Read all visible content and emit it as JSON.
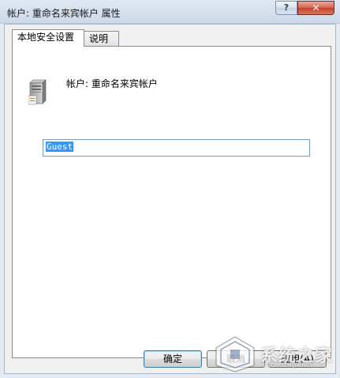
{
  "window": {
    "title": "帐户: 重命名来宾帐户 属性",
    "help_label": "?",
    "close_label": "✕"
  },
  "tabs": [
    {
      "label": "本地安全设置",
      "active": true
    },
    {
      "label": "说明",
      "active": false
    }
  ],
  "panel": {
    "icon": "server-icon",
    "policy_label": "帐户: 重命名来宾帐户",
    "input_value": "Guest"
  },
  "buttons": {
    "ok": "确定",
    "cancel": "取消",
    "apply": "应用(A)"
  },
  "watermark": {
    "text": "系统之家",
    "sub": "XITONGZHIJIA.NET"
  }
}
